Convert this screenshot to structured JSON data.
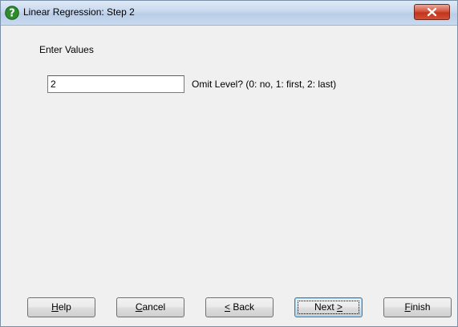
{
  "window": {
    "title": "Linear Regression: Step 2",
    "title_icon": "question-icon",
    "close_icon": "close-icon"
  },
  "form": {
    "section_label": "Enter Values",
    "value": "2",
    "omit_label": "Omit Level? (0: no, 1: first, 2: last)"
  },
  "buttons": {
    "help": {
      "mnemonic": "H",
      "rest": "elp"
    },
    "cancel": {
      "mnemonic": "C",
      "rest": "ancel"
    },
    "back": {
      "mnemonic": "<",
      "rest": " Back"
    },
    "next": {
      "pre": "Next ",
      "mnemonic": ">"
    },
    "finish": {
      "mnemonic": "F",
      "rest": "inish"
    }
  },
  "colors": {
    "close_button": "#c2341c",
    "title_bar": "#c7d8ee",
    "question_icon": "#2e8b2e"
  }
}
